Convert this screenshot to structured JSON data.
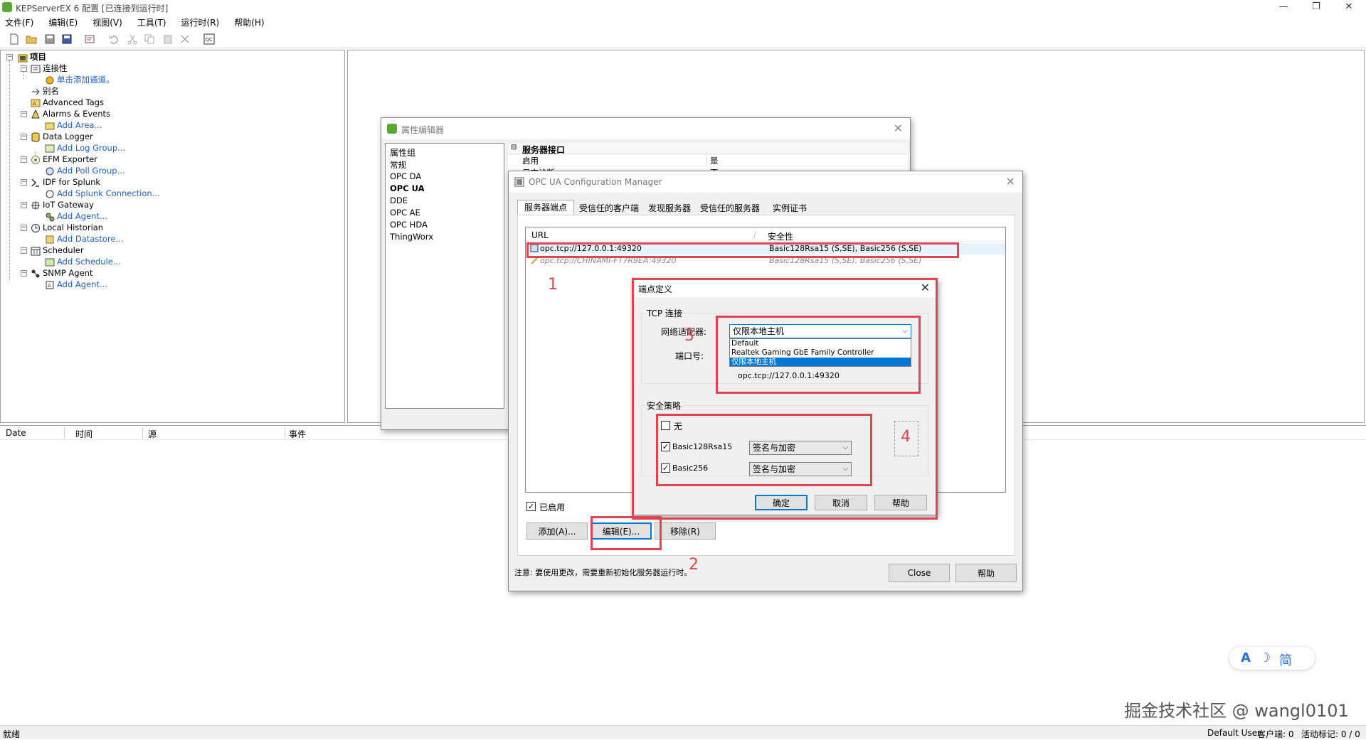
{
  "window": {
    "title": "KEPServerEX 6 配置 [已连接到运行时]",
    "min": "—",
    "max": "❐",
    "close": "✕"
  },
  "menu": [
    "文件(F)",
    "编辑(E)",
    "视图(V)",
    "工具(T)",
    "运行时(R)",
    "帮助(H)"
  ],
  "tree": {
    "root": "项目",
    "connectivity": "连接性",
    "add_channel": "单击添加通道。",
    "alias": "别名",
    "advanced_tags": "Advanced Tags",
    "alarms_events": "Alarms & Events",
    "add_area": "Add Area...",
    "data_logger": "Data Logger",
    "add_log_group": "Add Log Group...",
    "efm_exporter": "EFM Exporter",
    "add_poll_group": "Add Poll Group...",
    "idf_splunk": "IDF for Splunk",
    "add_splunk": "Add Splunk Connection...",
    "iot_gateway": "IoT Gateway",
    "add_agent": "Add Agent...",
    "local_historian": "Local Historian",
    "add_datastore": "Add Datastore...",
    "scheduler": "Scheduler",
    "add_schedule": "Add Schedule...",
    "snmp_agent": "SNMP Agent",
    "add_agent2": "Add Agent..."
  },
  "events": {
    "col_date": "Date",
    "col_time": "时间",
    "col_source": "源",
    "col_event": "事件"
  },
  "status": {
    "left": "就绪",
    "user": "Default User",
    "clients": "客户端: 0",
    "active_tags": "活动标记: 0 / 0"
  },
  "watermark": "掘金技术社区 @ wangl0101",
  "ime": {
    "a": "A",
    "moon": "☽",
    "mode": "简"
  },
  "prop_editor": {
    "title": "属性编辑器",
    "groups_header": "属性组",
    "groups": [
      "常规",
      "OPC DA",
      "OPC UA",
      "DDE",
      "OPC AE",
      "OPC HDA",
      "ThingWorx"
    ],
    "section": "服务器接口",
    "row1_name": "启用",
    "row1_value": "是",
    "row2_name": "日志诊断",
    "row2_value": "否"
  },
  "opcua": {
    "title": "OPC UA Configuration Manager",
    "tabs": [
      "服务器端点",
      "受信任的客户端",
      "发现服务器",
      "受信任的服务器",
      "实例证书"
    ],
    "col_url": "URL",
    "col_security": "安全性",
    "rows": [
      {
        "url": "opc.tcp://127.0.0.1:49320",
        "security": "Basic128Rsa15 (S,SE), Basic256 (S,SE)"
      },
      {
        "url": "opc.tcp://CHINAMI-FT7R9EA:49320",
        "security": "Basic128Rsa15 (S,SE), Basic256 (S,SE)"
      }
    ],
    "enabled_label": "已启用",
    "add_btn": "添加(A)...",
    "edit_btn": "编辑(E)...",
    "remove_btn": "移除(R)",
    "note": "注意: 要使用更改，需要重新初始化服务器运行时。",
    "close_btn": "Close",
    "help_btn": "帮助"
  },
  "endpoint": {
    "title": "端点定义",
    "tcp_group": "TCP 连接",
    "adapter_label": "网络适配器:",
    "adapter_value": "仅限本地主机",
    "adapter_options": [
      "Default",
      "Realtek Gaming GbE Family Controller",
      "仅限本地主机"
    ],
    "port_label": "端口号:",
    "url_preview": "opc.tcp://127.0.0.1:49320",
    "security_group": "安全策略",
    "none_label": "无",
    "policy1": "Basic128Rsa15",
    "policy1_mode": "签名与加密",
    "policy2": "Basic256",
    "policy2_mode": "签名与加密",
    "ok_btn": "确定",
    "cancel_btn": "取消",
    "help_btn": "帮助"
  },
  "annotations": [
    "1",
    "2",
    "3",
    "4"
  ],
  "colors": {
    "accent": "#0078d7",
    "annotation": "#e0454f",
    "link": "#1a5fcc"
  }
}
